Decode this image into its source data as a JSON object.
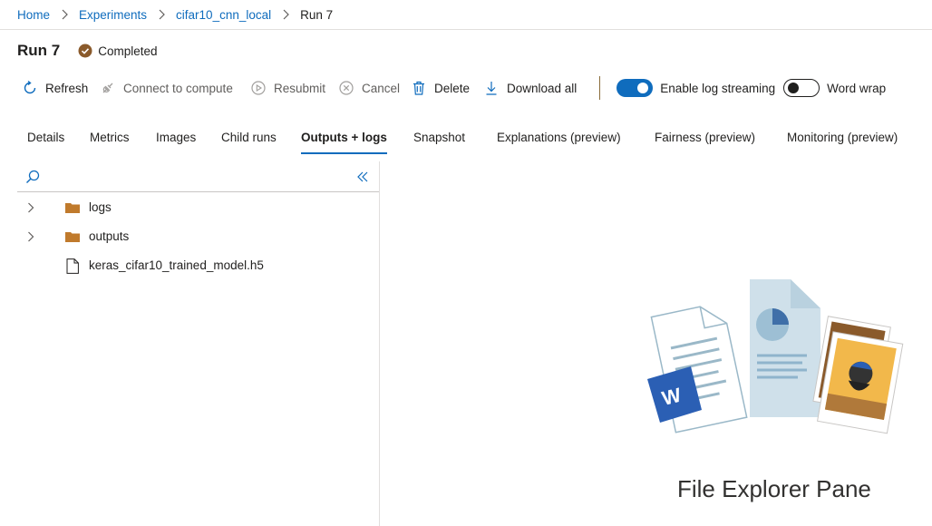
{
  "breadcrumb": {
    "items": [
      "Home",
      "Experiments",
      "cifar10_cnn_local"
    ],
    "current": "Run 7"
  },
  "header": {
    "title": "Run 7",
    "status": "Completed"
  },
  "toolbar": {
    "refresh": "Refresh",
    "connect": "Connect to compute",
    "resubmit": "Resubmit",
    "cancel": "Cancel",
    "delete": "Delete",
    "download": "Download all",
    "log_streaming": "Enable log streaming",
    "word_wrap": "Word wrap",
    "log_streaming_on": true,
    "word_wrap_on": false
  },
  "tabs": [
    "Details",
    "Metrics",
    "Images",
    "Child runs",
    "Outputs + logs",
    "Snapshot",
    "Explanations (preview)",
    "Fairness (preview)",
    "Monitoring (preview)"
  ],
  "active_tab": "Outputs + logs",
  "tree": {
    "items": [
      {
        "name": "logs",
        "type": "folder"
      },
      {
        "name": "outputs",
        "type": "folder"
      },
      {
        "name": "keras_cifar10_trained_model.h5",
        "type": "file"
      }
    ]
  },
  "empty_state": {
    "label": "File Explorer Pane"
  },
  "colors": {
    "accent": "#0f6cbd",
    "folder": "#c07a2c",
    "status": "#8a5a2b"
  }
}
